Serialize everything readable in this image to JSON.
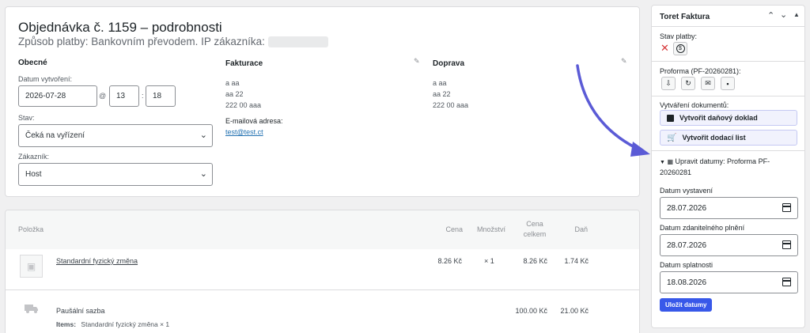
{
  "order": {
    "title": "Objednávka č. 1159 – podrobnosti",
    "subtitle": "Způsob platby: Bankovním převodem. IP zákazníka:",
    "general": {
      "heading": "Obecné",
      "date_label": "Datum vytvoření:",
      "date_value": "2026-07-28",
      "at": "@",
      "hour": "13",
      "colon": ":",
      "minute": "18",
      "status_label": "Stav:",
      "status_value": "Čeká na vyřízení",
      "customer_label": "Zákazník:",
      "customer_value": "Host"
    },
    "billing": {
      "heading": "Fakturace",
      "line1": "a aa",
      "line2": "aa 22",
      "line3": "222 00 aaa",
      "email_label": "E-mailová adresa:",
      "email_value": "test@test.ct"
    },
    "shipping": {
      "heading": "Doprava",
      "line1": "a aa",
      "line2": "aa 22",
      "line3": "222 00 aaa"
    }
  },
  "items": {
    "headers": {
      "item": "Položka",
      "price": "Cena",
      "qty": "Množství",
      "total_line1": "Cena",
      "total_line2": "celkem",
      "tax": "Daň"
    },
    "product": {
      "name": "Standardní fyzický změna",
      "price": "8.26 Kč",
      "qty": "× 1",
      "total": "8.26 Kč",
      "tax": "1.74 Kč"
    },
    "shipping_row": {
      "name": "Paušální sazba",
      "items_label": "Items:",
      "items_value": "Standardní fyzický změna × 1",
      "total": "100.00 Kč",
      "tax": "21.00 Kč"
    }
  },
  "sidebar": {
    "title": "Toret Faktura",
    "payment_status_label": "Stav platby:",
    "proforma_label": "Proforma (PF-20260281):",
    "documents_label": "Vytváření dokumentů:",
    "create_tax_doc": "Vytvořit daňový doklad",
    "create_delivery_note": "Vytvořit dodací list",
    "edit_dates_label": "Upravit datumy: Proforma PF-20260281",
    "issue_date_label": "Datum vystavení",
    "issue_date_value": "28.07.2026",
    "taxable_date_label": "Datum zdanitelného plnění",
    "taxable_date_value": "28.07.2026",
    "due_date_label": "Datum splatnosti",
    "due_date_value": "18.08.2026",
    "save_dates": "Uložit datumy"
  },
  "colors": {
    "accent": "#3858e9",
    "arrow": "#5b5bd6",
    "link": "#2271b1",
    "danger": "#d63638"
  }
}
